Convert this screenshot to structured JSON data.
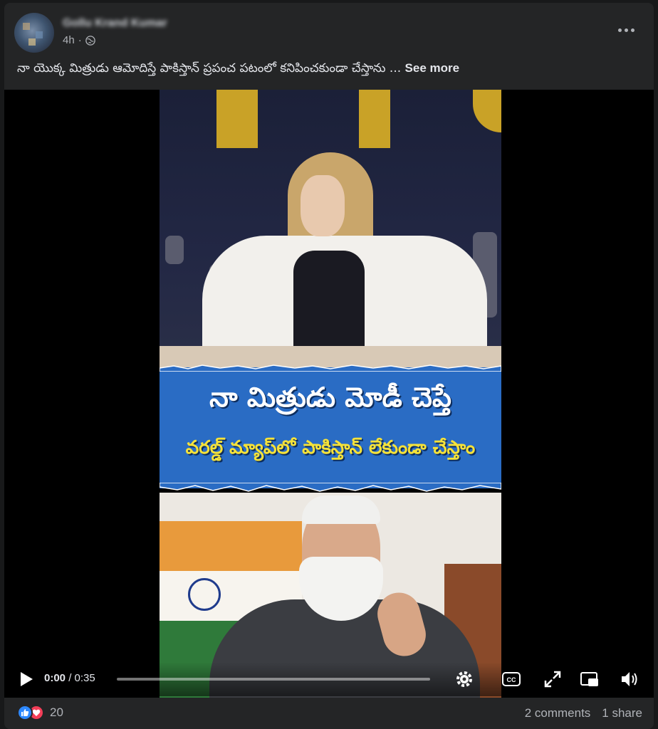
{
  "post": {
    "author": "Gollu Krand Kumar",
    "time": "4h",
    "audience_icon": "globe-icon",
    "caption": "నా యొక్క మిత్రుడు ఆమోదిస్తే పాకిస్తాన్ ప్రపంచ పటంలో కనిపించకుండా చేస్తాను ... ",
    "see_more": "See more"
  },
  "video": {
    "overlay_line1": "నా మిత్రుడు మోడీ చెప్తే",
    "overlay_line2": "వరల్డ్ మ్యాప్‌లో పాకిస్తాన్ లేకుండా చేస్తాం",
    "current_time": "0:00",
    "duration": "/ 0:35",
    "progress": 0.0,
    "controls": [
      "play-icon",
      "settings-icon",
      "captions-icon",
      "fullscreen-icon",
      "picture-in-picture-icon",
      "volume-icon"
    ]
  },
  "footer": {
    "reaction_count": "20",
    "comments": "2 comments",
    "shares": "1 share"
  },
  "colors": {
    "card": "#242526",
    "banner_blue": "#2a6cc4",
    "banner_yellow": "#f5e23a",
    "like_blue": "#2d88ff",
    "love_red": "#f33e58"
  }
}
